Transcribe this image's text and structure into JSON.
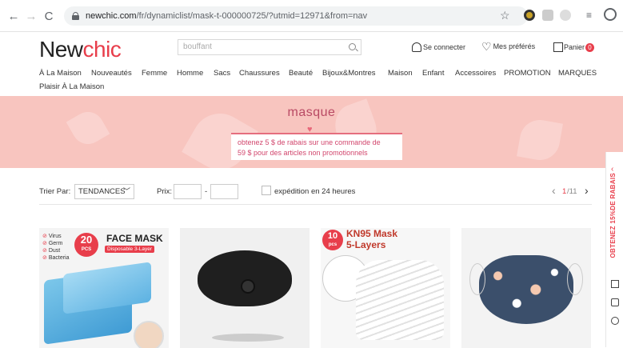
{
  "browser": {
    "url_host": "newchic.com",
    "url_path": "/fr/dynamiclist/mask-t-000000725/?utmid=12971&from=nav"
  },
  "header": {
    "logo_new": "New",
    "logo_chic": "chic",
    "search_placeholder": "bouffant",
    "login": "Se connecter",
    "favorites": "Mes préférés",
    "cart": "Panier",
    "cart_count": "0"
  },
  "menu": {
    "items": [
      "À La Maison",
      "Nouveautés",
      "Femme",
      "Homme",
      "Sacs",
      "Chaussures",
      "Beauté",
      "Bijoux&Montres",
      "Maison",
      "Enfant",
      "Accessoires",
      "PROMOTION",
      "MARQUES"
    ],
    "second_line": "Plaisir À La Maison"
  },
  "banner": {
    "title": "masque",
    "promo_line1": "obtenez 5 $ de rabais sur une commande de",
    "promo_line2": "59 $ pour des articles non promotionnels"
  },
  "filters": {
    "sort_label": "Trier Par:",
    "sort_value": "TENDANCES",
    "price_label": "Prix:",
    "price_sep": "-",
    "shipping_label": "expédition en 24 heures",
    "page_current": "1",
    "page_total": "/11"
  },
  "products": [
    {
      "title": "FACE MASK",
      "pcs": "20",
      "pcs_unit": "PCS",
      "subtitle": "Disposable 3-Layer",
      "tags": [
        "Virus",
        "Germ",
        "Dust",
        "Bacteria"
      ]
    },
    {
      "title": ""
    },
    {
      "title": "KN95 Mask",
      "subtitle": "5-Layers",
      "pcs": "10",
      "pcs_unit": "pcs"
    },
    {
      "title": ""
    }
  ],
  "sidebar": {
    "promo": "OBTENEZ 15%DE RABAIS"
  }
}
